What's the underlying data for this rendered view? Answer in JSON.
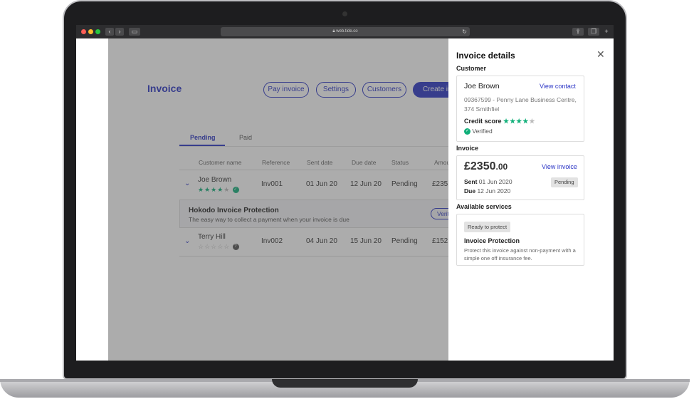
{
  "browser": {
    "url": "web.tide.co"
  },
  "app": {
    "title": "Invoice",
    "buttons": {
      "pay_invoice": "Pay invoice",
      "settings": "Settings",
      "customers": "Customers",
      "create_invoice": "Create in"
    },
    "tabs": [
      {
        "label": "Pending"
      },
      {
        "label": "Paid"
      }
    ],
    "columns": [
      "Customer name",
      "Reference",
      "Sent date",
      "Due date",
      "Status",
      "Amou"
    ],
    "rows": [
      {
        "customer": "Joe Brown",
        "rating": 4,
        "verified": true,
        "reference": "Inv001",
        "sent": "01 Jun 20",
        "due": "12 Jun 20",
        "status": "Pending",
        "amount": "£235"
      },
      {
        "customer": "Terry Hill",
        "rating": 0,
        "verified": false,
        "reference": "Inv002",
        "sent": "04 Jun 20",
        "due": "15 Jun 20",
        "status": "Pending",
        "amount": "£152"
      }
    ],
    "protection": {
      "title": "Hokodo Invoice Protection",
      "subtitle": "The easy way to collect a payment when your invoice is due",
      "button": "Verit"
    }
  },
  "drawer": {
    "title": "Invoice details",
    "customer_label": "Customer",
    "customer": {
      "name": "Joe Brown",
      "view_contact": "View contact",
      "address": "09367599 - Penny Lane Business Centre, 374 Smithfiel",
      "credit_label": "Credit score",
      "rating": 4,
      "verified": "Verified"
    },
    "invoice_label": "Invoice",
    "invoice": {
      "amount_main": "£2350",
      "amount_cents": ".00",
      "view_invoice": "View invoice",
      "sent_label": "Sent",
      "sent_value": "01 Jun 2020",
      "due_label": "Due",
      "due_value": "12 Jun 2020",
      "status": "Pending"
    },
    "services_label": "Available services",
    "service": {
      "chip": "Ready to protect",
      "title": "Invoice Protection",
      "description": "Protect this invoice against non-payment with a simple one off insurance fee."
    }
  },
  "colors": {
    "accent": "#2b35c5",
    "star": "#11b07a",
    "star_empty": "#bbbbbb"
  }
}
